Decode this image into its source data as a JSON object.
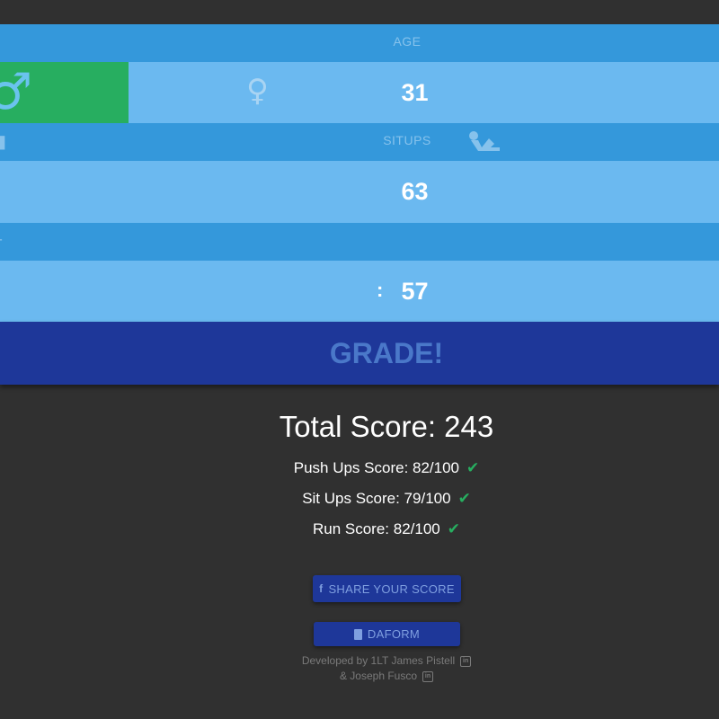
{
  "form": {
    "age": {
      "header_label": "AGE",
      "value": "31",
      "male_icon_glyph": "♂",
      "female_icon_glyph": "♀",
      "selected_gender": "male"
    },
    "situps": {
      "header_label": "SITUPS",
      "value": "63",
      "pushup_icon": "pushup-icon",
      "situp_icon": "situp-icon"
    },
    "run": {
      "header_label": "",
      "separator": ":",
      "value": "57"
    }
  },
  "grade_button": {
    "label": "GRADE!"
  },
  "results": {
    "total_label": "Total Score: 243",
    "pushups_label": "Push Ups Score: 82/100",
    "situps_label": "Sit Ups Score: 79/100",
    "run_label": "Run Score: 82/100",
    "check_glyph": "✔"
  },
  "actions": {
    "share_label": "SHARE YOUR SCORE",
    "share_icon_glyph": "f",
    "daform_label": "DAFORM"
  },
  "credits": {
    "line1": "Developed by 1LT James Pistell",
    "line2": "& Joseph Fusco",
    "linkedin_glyph": "in"
  },
  "colors": {
    "header_band": "#3498db",
    "value_band": "#6bb9f0",
    "male_selected": "#27ae60",
    "grade_button": "#1e3799",
    "background": "#303030",
    "check": "#27ae60"
  }
}
